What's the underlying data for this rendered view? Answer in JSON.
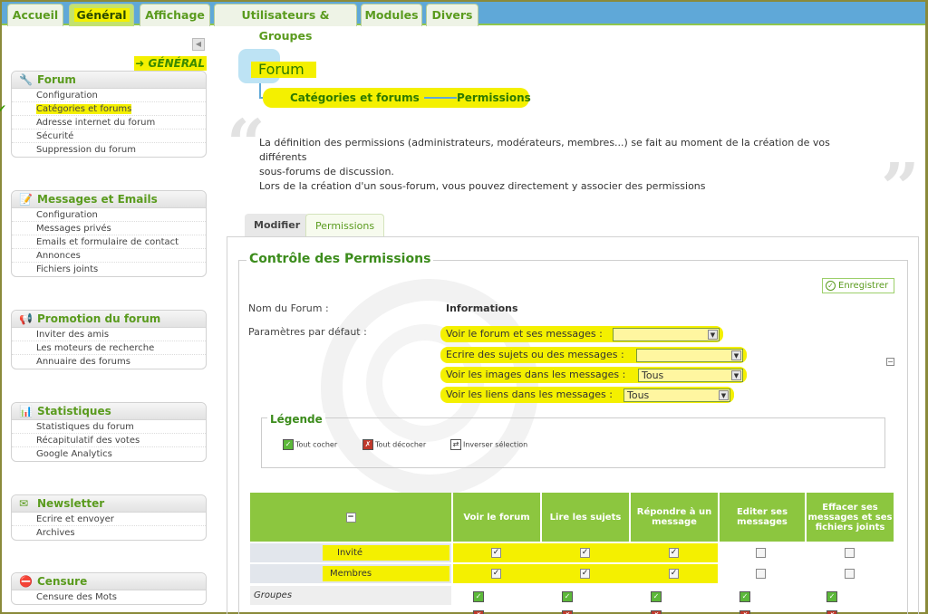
{
  "tabs": [
    {
      "label": "Accueil",
      "active": false
    },
    {
      "label": "Général",
      "active": true
    },
    {
      "label": "Affichage",
      "active": false
    },
    {
      "label": "Utilisateurs & Groupes",
      "active": false
    },
    {
      "label": "Modules",
      "active": false
    },
    {
      "label": "Divers",
      "active": false
    }
  ],
  "sidebar": {
    "section_label": "➜ GÉNÉRAL",
    "collapse_icon": "◀",
    "boxes": [
      {
        "title": "Forum",
        "icon": "forum-icon",
        "items": [
          "Configuration",
          "Catégories et forums",
          "Adresse internet du forum",
          "Sécurité",
          "Suppression du forum"
        ],
        "selected": 1
      },
      {
        "title": "Messages et Emails",
        "icon": "messages-icon",
        "items": [
          "Configuration",
          "Messages privés",
          "Emails et formulaire de contact",
          "Annonces",
          "Fichiers joints"
        ]
      },
      {
        "title": "Promotion du forum",
        "icon": "promotion-icon",
        "items": [
          "Inviter des amis",
          "Les moteurs de recherche",
          "Annuaire des forums"
        ]
      },
      {
        "title": "Statistiques",
        "icon": "stats-icon",
        "items": [
          "Statistiques du forum",
          "Récapitulatif des votes",
          "Google Analytics"
        ]
      },
      {
        "title": "Newsletter",
        "icon": "newsletter-icon",
        "items": [
          "Ecrire et envoyer",
          "Archives"
        ]
      },
      {
        "title": "Censure",
        "icon": "censure-icon",
        "items": [
          "Censure des Mots"
        ]
      }
    ]
  },
  "main": {
    "title": "Forum",
    "breadcrumb": [
      "Catégories et forums",
      "Permissions"
    ],
    "description": [
      "La définition des permissions (administrateurs, modérateurs, membres...) se fait au moment de la création de vos différents",
      "sous-forums de discussion.",
      "Lors de la création d'un sous-forum, vous pouvez directement y associer des permissions"
    ],
    "content_tabs": [
      {
        "label": "Modifier"
      },
      {
        "label": "Permissions"
      }
    ],
    "panel_title": "Contrôle des Permissions",
    "save_label": "Enregistrer",
    "forum_name_label": "Nom du Forum :",
    "forum_name_value": "Informations",
    "defaults_label": "Paramètres par défaut :",
    "default_params": [
      {
        "label": "Voir le forum et ses messages :",
        "value": ""
      },
      {
        "label": "Ecrire des sujets ou des messages :",
        "value": ""
      },
      {
        "label": "Voir les images dans les messages :",
        "value": "Tous"
      },
      {
        "label": "Voir les liens dans les messages :",
        "value": "Tous"
      }
    ],
    "legend": {
      "title": "Légende",
      "items": [
        "Tout cocher",
        "Tout décocher",
        "Inverser sélection"
      ]
    },
    "table": {
      "columns": [
        "Voir le forum",
        "Lire les sujets",
        "Répondre à un message",
        "Editer ses messages",
        "Effacer ses messages et ses fichiers joints"
      ],
      "rows": [
        {
          "name": "Invité",
          "values": [
            true,
            true,
            true,
            false,
            false
          ]
        },
        {
          "name": "Membres",
          "values": [
            true,
            true,
            true,
            false,
            false
          ]
        }
      ],
      "groups_label": "Groupes"
    }
  }
}
